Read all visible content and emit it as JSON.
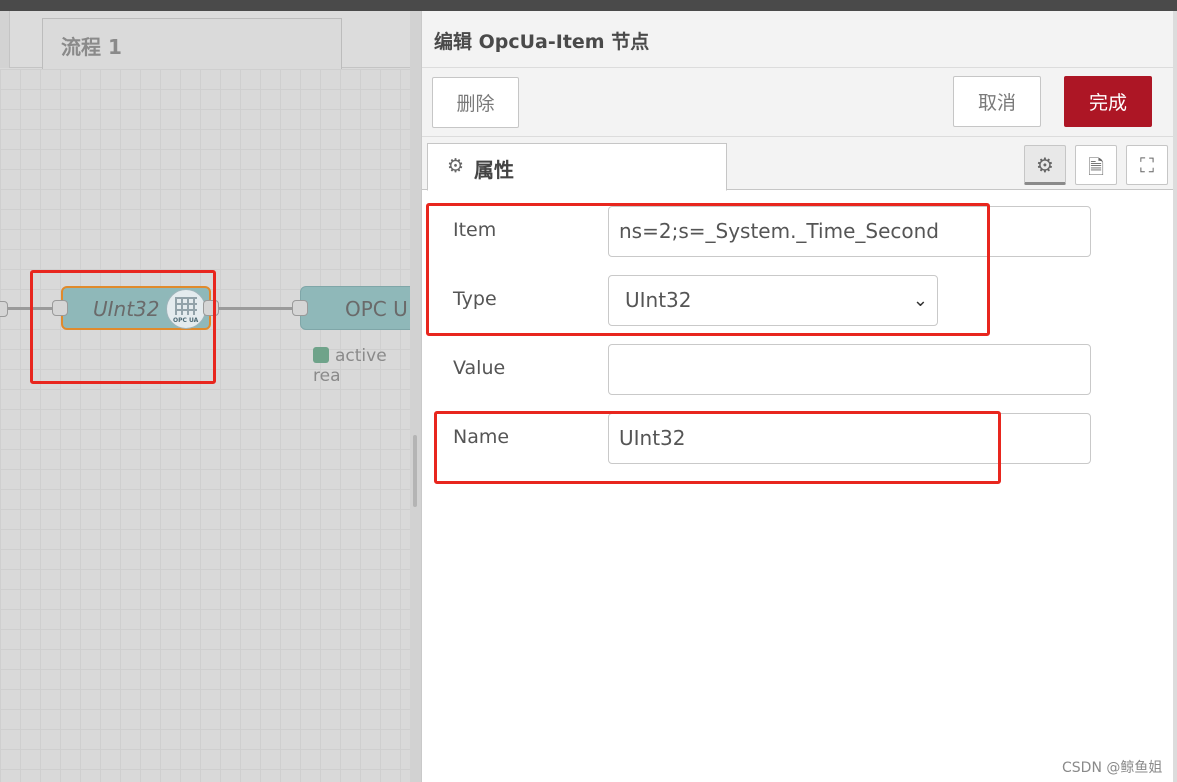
{
  "workspace": {
    "flow_tab": "流程 1",
    "nodes": {
      "uint_node_label": "UInt32",
      "uint_icon_text": "OPC UA",
      "opc_node_label": "OPC U",
      "opc_status": "active rea"
    }
  },
  "editor": {
    "title": "编辑 OpcUa-Item 节点",
    "toolbar": {
      "delete_label": "删除",
      "cancel_label": "取消",
      "done_label": "完成"
    },
    "tabs": {
      "properties_label": "属性",
      "icons": [
        "gear-icon",
        "document-icon",
        "frame-icon"
      ]
    },
    "form": {
      "item_label": "Item",
      "item_value": "ns=2;s=_System._Time_Second",
      "type_label": "Type",
      "type_value": "UInt32",
      "value_label": "Value",
      "value_value": "",
      "name_label": "Name",
      "name_value": "UInt32"
    }
  },
  "watermark": "CSDN @鲸鱼姐",
  "colors": {
    "done_button": "#ad1625",
    "highlight_box": "#e8261e",
    "node_fill": "#8fb8b9",
    "selected_node_border": "#e08a2c"
  }
}
